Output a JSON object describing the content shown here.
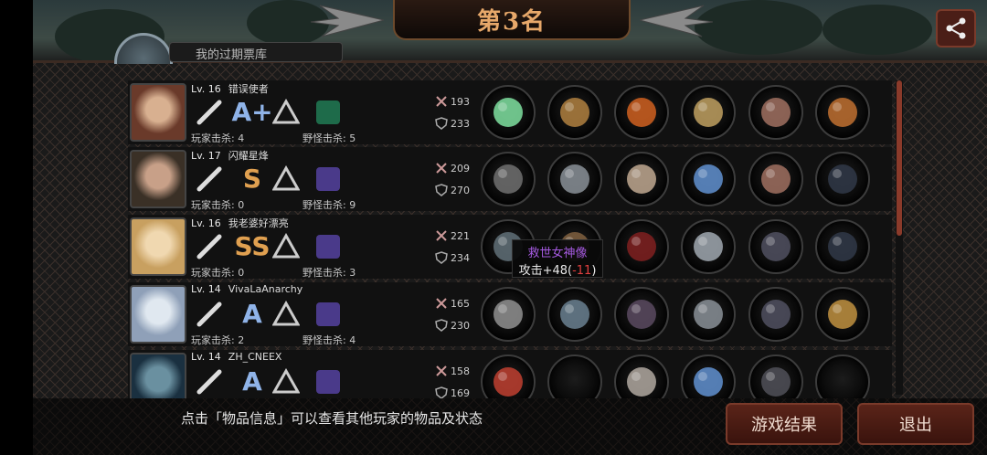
{
  "header": {
    "title": "第3名",
    "top_label": "我的过期票库"
  },
  "players": [
    {
      "level": "Lv. 16",
      "name": "错误使者",
      "rank": "A+",
      "rank_color": "#8fb3e8",
      "player_kills": "玩家击杀: 4",
      "monster_kills": "野怪击杀: 5",
      "attack": "193",
      "defense": "233",
      "weapon_icon": "bat-icon",
      "beast_color": "#1e6b4a",
      "items": [
        "twin-swords-icon",
        "helmet-icon",
        "flame-armor-icon",
        "shield-icon",
        "gauntlet-icon",
        "cross-staff-icon"
      ]
    },
    {
      "level": "Lv. 17",
      "name": "闪耀星烽",
      "rank": "S",
      "rank_color": "#e0a050",
      "player_kills": "玩家击杀: 0",
      "monster_kills": "野怪击杀: 9",
      "attack": "209",
      "defense": "270",
      "weapon_icon": "shuriken-icon",
      "beast_color": "#4a3a8a",
      "items": [
        "boomerang-icon",
        "visor-helmet-icon",
        "plate-armor-icon",
        "crystal-claw-icon",
        "gauntlet-icon",
        "banner-icon"
      ]
    },
    {
      "level": "Lv. 16",
      "name": "我老婆好漂亮",
      "rank": "SS",
      "rank_color": "#e0a050",
      "player_kills": "玩家击杀: 0",
      "monster_kills": "野怪击杀: 3",
      "attack": "221",
      "defense": "234",
      "weapon_icon": "bat-icon",
      "beast_color": "#4a3a8a",
      "items": [
        "dark-helm-icon",
        "horned-helm-icon",
        "demon-armor-icon",
        "spiked-bracer-icon",
        "dark-glove-icon",
        "banner-icon"
      ]
    },
    {
      "level": "Lv. 14",
      "name": "VivaLaAnarchy",
      "rank": "A",
      "rank_color": "#8fb3e8",
      "player_kills": "玩家击杀: 2",
      "monster_kills": "野怪击杀: 4",
      "attack": "165",
      "defense": "230",
      "weapon_icon": "knife-icon",
      "beast_color": "#4a3a8a",
      "items": [
        "scythe-icon",
        "knight-helm-icon",
        "dark-armor-icon",
        "bracelet-icon",
        "dark-glove-icon",
        "treasure-box-icon"
      ]
    },
    {
      "level": "Lv. 14",
      "name": "ZH_CNEEX",
      "rank": "A",
      "rank_color": "#8fb3e8",
      "player_kills": "",
      "monster_kills": "",
      "attack": "158",
      "defense": "169",
      "weapon_icon": "fist-icon",
      "beast_color": "#4a3a8a",
      "items": [
        "boxing-glove-icon",
        "empty-slot",
        "chest-plate-icon",
        "crystal-claw-icon",
        "boot-icon",
        "empty-slot"
      ]
    }
  ],
  "tooltip": {
    "name": "救世女神像",
    "stat_prefix": "攻击+48(",
    "stat_neg": "-11",
    "stat_suffix": ")"
  },
  "footer": {
    "hint": "点击「物品信息」可以查看其他玩家的物品及状态",
    "result_button": "游戏结果",
    "exit_button": "退出"
  }
}
